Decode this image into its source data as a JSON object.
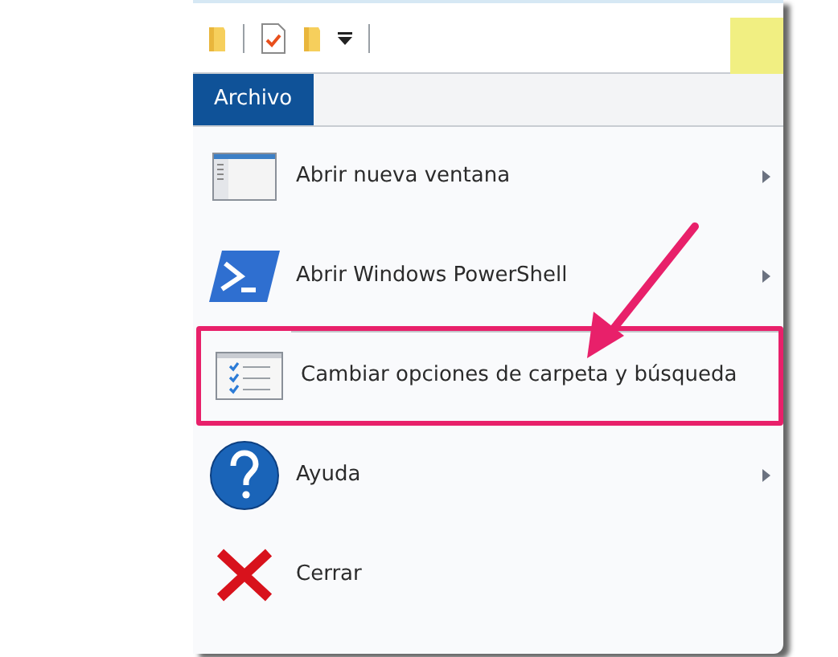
{
  "toolbar": {
    "items": [
      {
        "kind": "folder"
      },
      {
        "kind": "separator"
      },
      {
        "kind": "properties"
      },
      {
        "kind": "folder"
      },
      {
        "kind": "dropdown"
      },
      {
        "kind": "separator"
      }
    ]
  },
  "ribbon": {
    "tabs": [
      {
        "label": "Archivo",
        "selected": true
      }
    ]
  },
  "menu": {
    "items": [
      {
        "label": "Abrir nueva ventana",
        "kind": "window",
        "submenu": true,
        "highlighted": false,
        "separator_before": false
      },
      {
        "label": "Abrir Windows PowerShell",
        "kind": "powershell",
        "submenu": true,
        "highlighted": false,
        "separator_before": false
      },
      {
        "label": "Cambiar opciones de carpeta y búsqueda",
        "kind": "options",
        "submenu": false,
        "highlighted": true,
        "separator_before": true
      },
      {
        "label": "Ayuda",
        "kind": "help",
        "submenu": true,
        "highlighted": false,
        "separator_before": false
      },
      {
        "label": "Cerrar",
        "kind": "close",
        "submenu": false,
        "highlighted": false,
        "separator_before": false
      }
    ]
  }
}
